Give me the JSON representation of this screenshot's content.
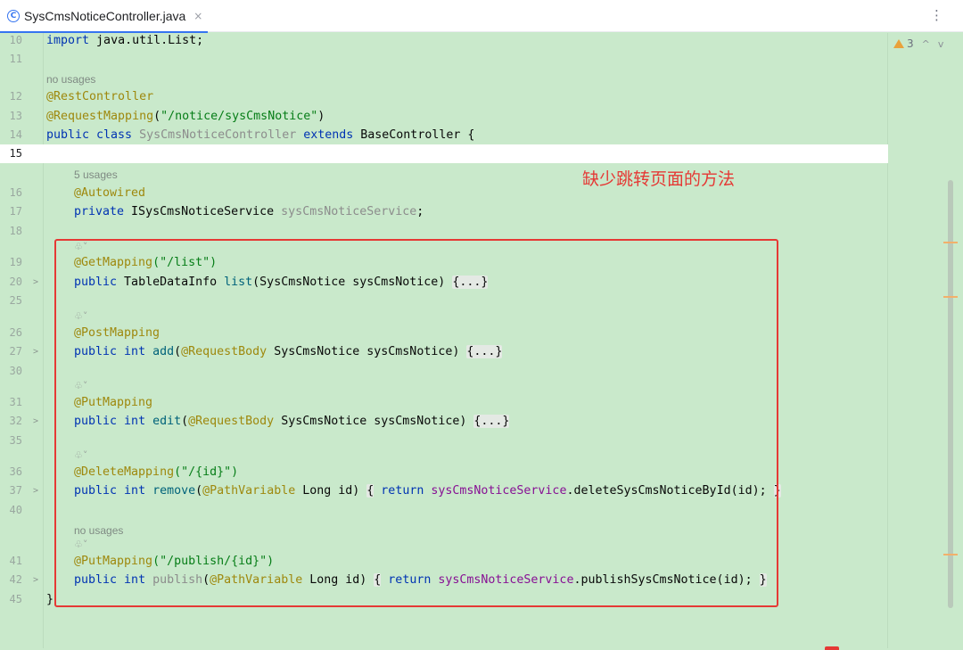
{
  "tab": {
    "icon_label": "C",
    "title": "SysCmsNoticeController.java",
    "close_glyph": "×",
    "more_glyph": "⋮"
  },
  "inspection": {
    "warning_count": "3",
    "up_glyph": "^",
    "down_glyph": "v"
  },
  "annotation": {
    "note": "缺少跳转页面的方法"
  },
  "hints": {
    "no_usages": "no usages",
    "five_usages": "5 usages",
    "ai_glyph": "♧˅"
  },
  "line_numbers": [
    "10",
    "11",
    "12",
    "13",
    "14",
    "15",
    "16",
    "17",
    "18",
    "19",
    "20",
    "25",
    "26",
    "27",
    "30",
    "31",
    "32",
    "35",
    "36",
    "37",
    "40",
    "41",
    "42",
    "45"
  ],
  "code": {
    "import": "import",
    "import_path": " java.util.List;",
    "rest_controller": "@RestController",
    "request_mapping": "@RequestMapping",
    "request_mapping_open": "(",
    "request_mapping_path": "\"/notice/sysCmsNotice\"",
    "request_mapping_close": ")",
    "public_class": "public class",
    "class_name": " SysCmsNoticeController ",
    "extends": "extends",
    "base_class": " BaseController {",
    "autowired": "@Autowired",
    "private": "private",
    "service_type": " ISysCmsNoticeService ",
    "service_field": "sysCmsNoticeService",
    "semicolon": ";",
    "get_mapping": "@GetMapping",
    "list_path": "(\"/list\")",
    "public": "public",
    "table_type": " TableDataInfo ",
    "list_method": "list",
    "list_params": "(SysCmsNotice sysCmsNotice) ",
    "folded_body": "{...}",
    "post_mapping": "@PostMapping",
    "int": " int ",
    "add_method": "add",
    "paren_open": "(",
    "request_body": "@RequestBody",
    "notice_param": " SysCmsNotice sysCmsNotice) ",
    "put_mapping": "@PutMapping",
    "edit_method": "edit",
    "delete_mapping": "@DeleteMapping",
    "id_path": "(\"/{id}\")",
    "remove_method": "remove",
    "path_variable": "@PathVariable",
    "long_id": " Long id) ",
    "brace_open": "{",
    "return": " return ",
    "delete_call": ".deleteSysCmsNoticeById(id); ",
    "brace_close": "}",
    "publish_path": "(\"/publish/{id}\")",
    "publish_method": "publish",
    "publish_call": ".publishSysCmsNotice(id); ",
    "class_close": "}"
  }
}
